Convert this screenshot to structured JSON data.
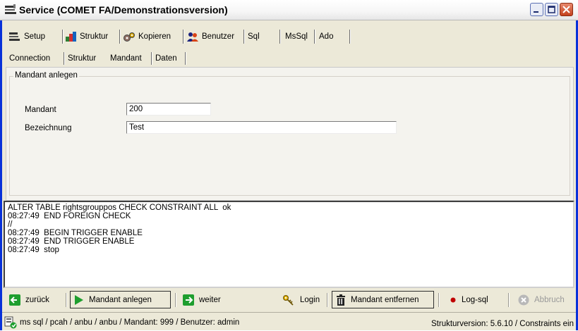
{
  "window": {
    "title": "Service (COMET FA/Demonstrationsversion)"
  },
  "main_tabs": [
    "Setup",
    "Struktur",
    "Kopieren",
    "Benutzer",
    "Sql",
    "MsSql",
    "Ado"
  ],
  "sub_tabs": [
    "Connection",
    "Struktur",
    "Mandant",
    "Daten"
  ],
  "group": {
    "title": "Mandant anlegen",
    "mandant_label": "Mandant",
    "mandant_value": "200",
    "bezeichnung_label": "Bezeichnung",
    "bezeichnung_value": "Test"
  },
  "log_lines": [
    "ALTER TABLE rightsgrouppos CHECK CONSTRAINT ALL  ok",
    "08:27:49  END FOREIGN CHECK",
    "//",
    "08:27:49  BEGIN TRIGGER ENABLE",
    "08:27:49  END TRIGGER ENABLE",
    "08:27:49  stop"
  ],
  "buttons": {
    "back": "zurück",
    "create": "Mandant anlegen",
    "next": "weiter",
    "login": "Login",
    "remove": "Mandant entfernen",
    "logsql": "Log-sql",
    "abort": "Abbruch"
  },
  "status": {
    "left": "ms sql / pcah / anbu / anbu / Mandant: 999 / Benutzer: admin",
    "right": "Strukturversion: 5.6.10 / Constraints ein"
  },
  "colors": {
    "window_border": "#0831d9",
    "green": "#1e9e2e",
    "log_red": "#c00000"
  }
}
